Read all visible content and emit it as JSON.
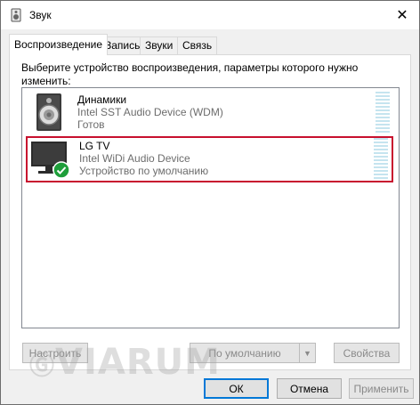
{
  "window": {
    "title": "Звук",
    "close_icon": "close-icon",
    "title_icon": "speaker-icon"
  },
  "tabs": [
    {
      "label": "Воспроизведение",
      "active": true
    },
    {
      "label": "Запись",
      "active": false
    },
    {
      "label": "Звуки",
      "active": false
    },
    {
      "label": "Связь",
      "active": false
    }
  ],
  "panel": {
    "instruction": "Выберите устройство воспроизведения, параметры которого нужно изменить:"
  },
  "devices": [
    {
      "name": "Динамики",
      "line2": "Intel SST Audio Device (WDM)",
      "line3": "Готов",
      "icon": "speaker-device-icon",
      "selected": false
    },
    {
      "name": "LG TV",
      "line2": "Intel WiDi Audio Device",
      "line3": "Устройство по умолчанию",
      "icon": "tv-device-icon",
      "status_icon": "default-check-icon",
      "selected": true
    }
  ],
  "buttons": {
    "configure": "Настроить",
    "set_default": "По умолчанию",
    "properties": "Свойства",
    "ok": "ОК",
    "cancel": "Отмена",
    "apply": "Применить"
  },
  "watermark": "VIARUM",
  "colors": {
    "selection_border": "#c8102e",
    "check_green": "#1e9e3a",
    "level_meter": "#c5e4ef",
    "default_button_border": "#0078d7"
  }
}
